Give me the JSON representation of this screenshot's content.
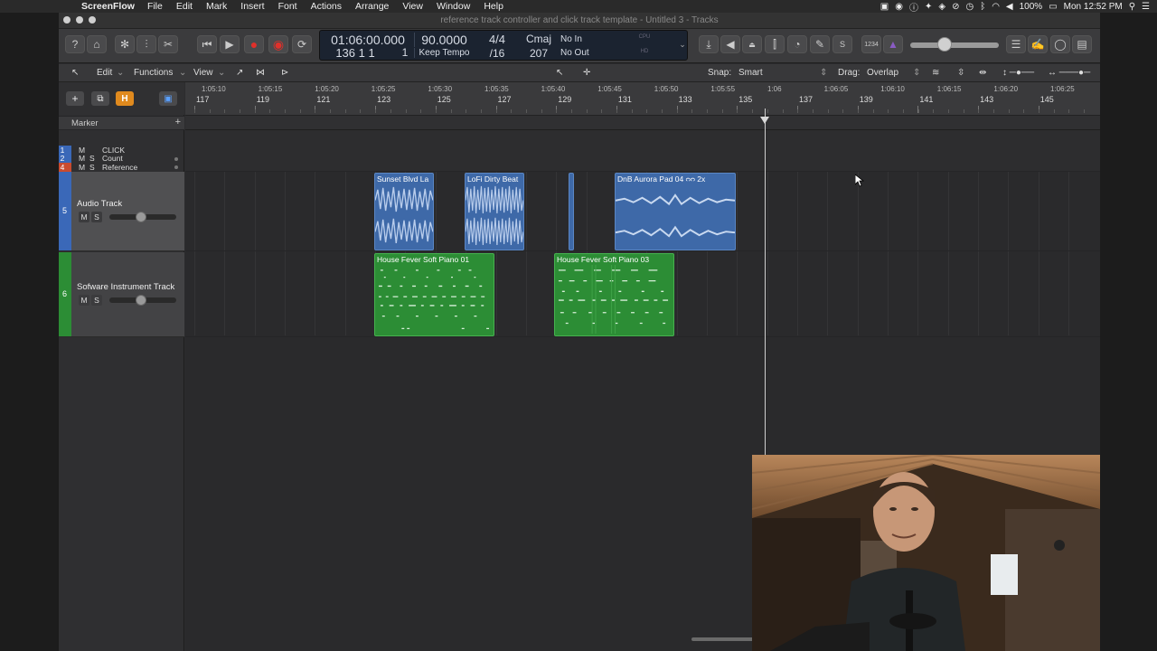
{
  "menubar": {
    "app_name": "ScreenFlow",
    "items": [
      "File",
      "Edit",
      "Mark",
      "Insert",
      "Font",
      "Actions",
      "Arrange",
      "View",
      "Window",
      "Help"
    ],
    "battery": "100%",
    "clock": "Mon 12:52 PM"
  },
  "window": {
    "title": "reference track controller and click track template - Untitled 3 - Tracks"
  },
  "lcd": {
    "timecode": "01:06:00.000",
    "bars": "136  1  1",
    "beat_sub": "1",
    "tempo": "90.0000",
    "tempo_mode": "Keep Tempo",
    "signature_top": "4/4",
    "signature_bottom": "/16",
    "key": "Cmaj",
    "key_value": "207",
    "in": "No In",
    "out": "No Out",
    "cpu": "CPU",
    "hd": "HD"
  },
  "editbar": {
    "edit": "Edit",
    "functions": "Functions",
    "view": "View",
    "snap_label": "Snap:",
    "snap_value": "Smart",
    "drag_label": "Drag:",
    "drag_value": "Overlap"
  },
  "tracks": {
    "marker": "Marker",
    "global": [
      {
        "num": "1",
        "m": "M",
        "s": "",
        "name": "CLICK",
        "color": "#3a68b8"
      },
      {
        "num": "2",
        "m": "M",
        "s": "S",
        "name": "Count",
        "color": "#3a68b8"
      },
      {
        "num": "4",
        "m": "M",
        "s": "S",
        "name": "Reference",
        "color": "#c94b2f"
      }
    ],
    "audio": {
      "num": "5",
      "name": "Audio Track",
      "m": "M",
      "s": "S",
      "color": "#3a68b8"
    },
    "instrument": {
      "num": "6",
      "name": "Sofware Instrument Track",
      "m": "M",
      "s": "S",
      "color": "#2c8d35"
    }
  },
  "ruler": {
    "times": [
      "1:05:10",
      "1:05:15",
      "1:05:20",
      "1:05:25",
      "1:05:30",
      "1:05:35",
      "1:05:40",
      "1:05:45",
      "1:05:50",
      "1:05:55",
      "1:06",
      "1:06:05",
      "1:06:10",
      "1:06:15",
      "1:06:20",
      "1:06:25"
    ],
    "bars": [
      "117",
      "119",
      "121",
      "123",
      "125",
      "127",
      "129",
      "131",
      "133",
      "135",
      "137",
      "139",
      "141",
      "143",
      "145"
    ]
  },
  "regions": {
    "audio": [
      {
        "name": "Sunset Blvd La"
      },
      {
        "name": "LoFi Dirty Beat"
      },
      {
        "name": ""
      },
      {
        "name": "DnB Aurora Pad 04  ᴒᴒ  2x"
      }
    ],
    "midi": [
      {
        "name": "House Fever Soft Piano 01"
      },
      {
        "name": "House Fever Soft Piano 03"
      }
    ]
  },
  "colors": {
    "audio_region": "#3e69a8",
    "midi_region": "#2c8d35",
    "record": "#e0302a",
    "hide_button": "#e08a1e"
  }
}
